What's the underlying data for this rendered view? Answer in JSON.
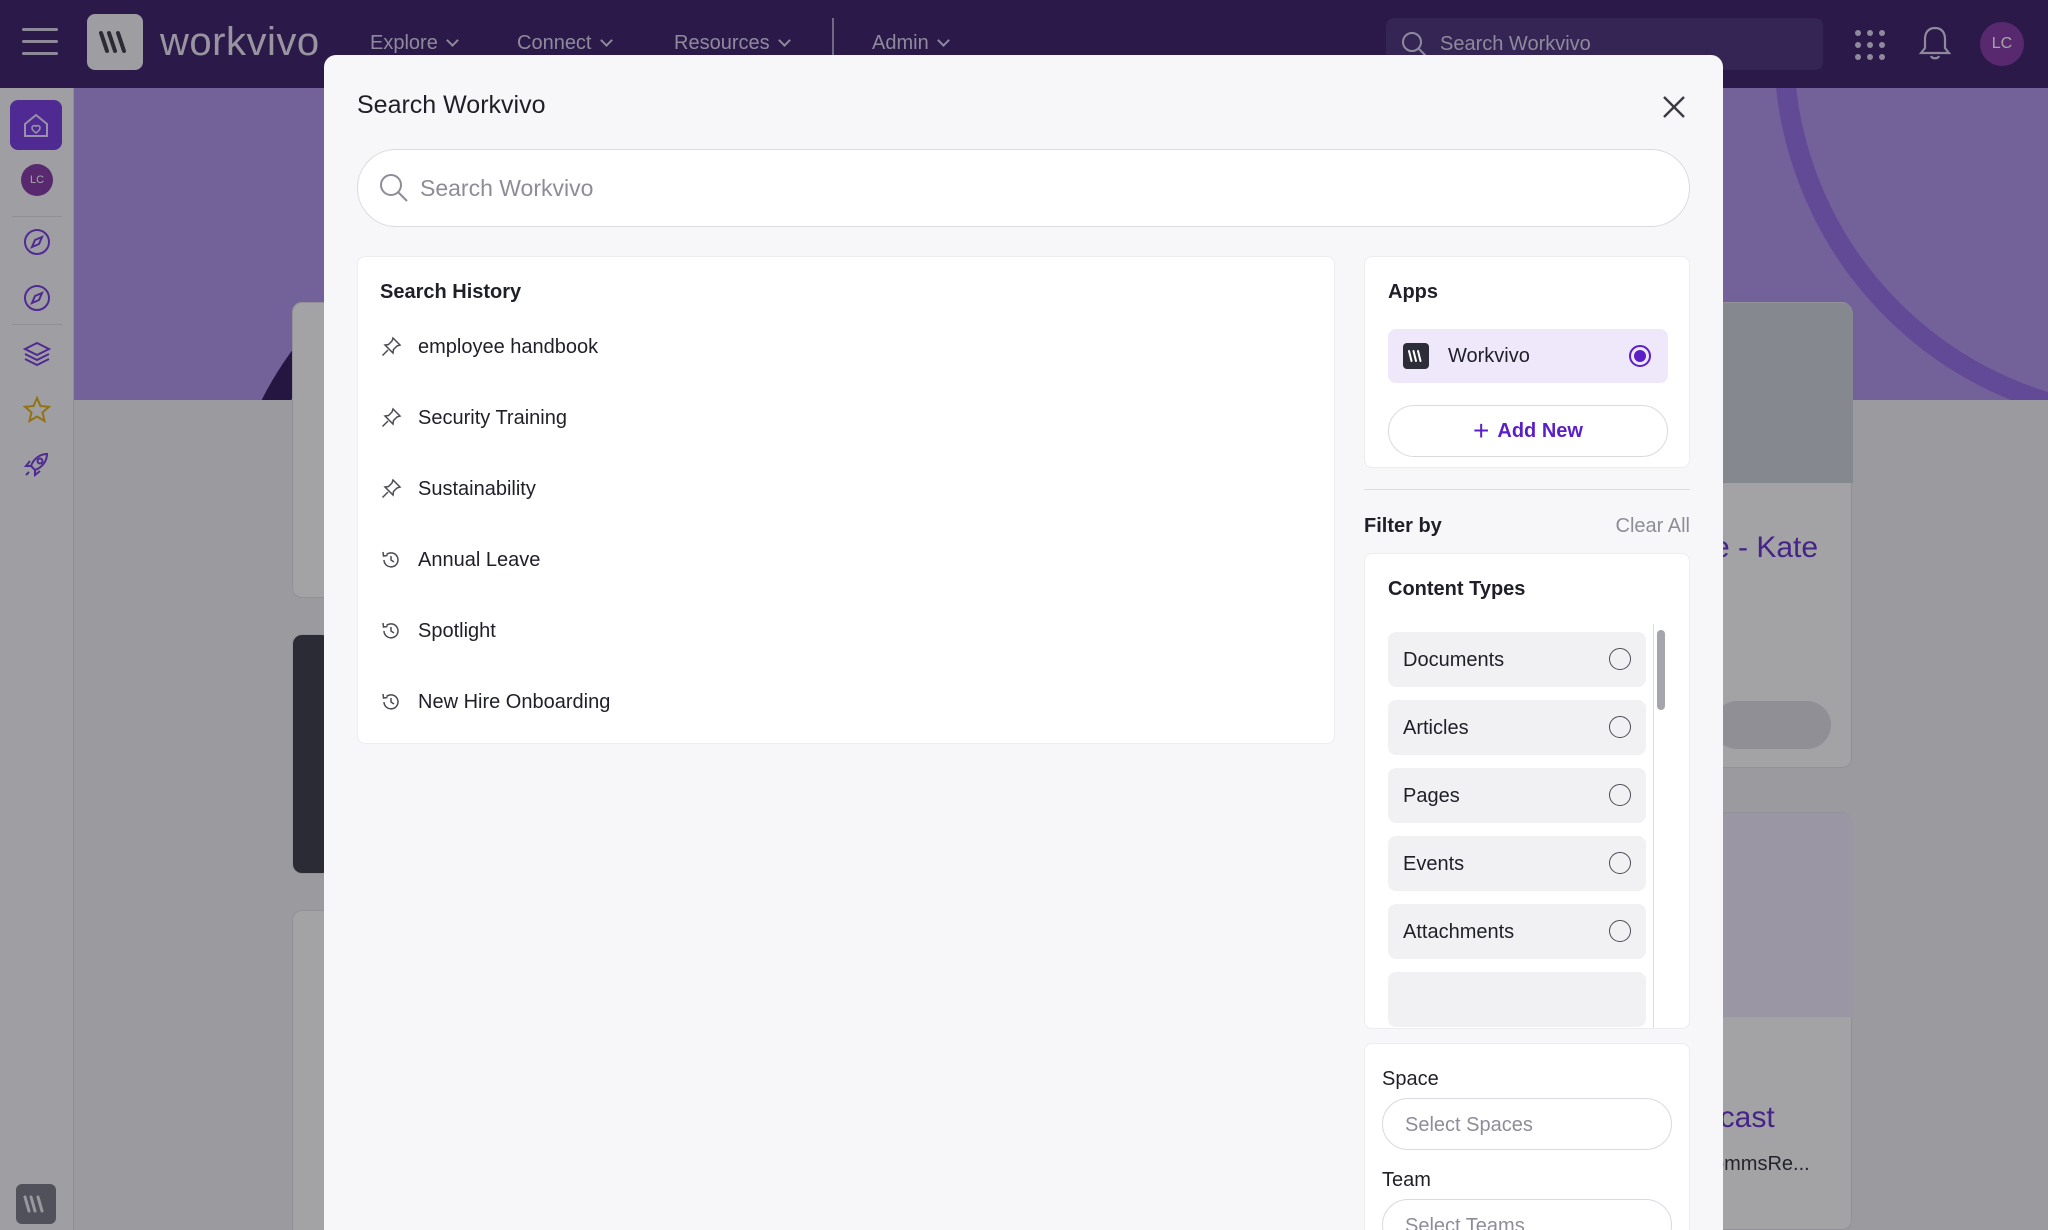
{
  "topbar": {
    "brand": "workvivo",
    "nav": [
      {
        "label": "Explore"
      },
      {
        "label": "Connect"
      },
      {
        "label": "Resources"
      },
      {
        "label": "Admin"
      }
    ],
    "search_placeholder": "Search Workvivo",
    "user_initials": "LC"
  },
  "rail": {
    "user_initials": "LC",
    "icons": [
      "home-icon",
      "compass-icon",
      "compass-icon",
      "layers-icon",
      "star-icon",
      "rocket-icon"
    ]
  },
  "background": {
    "card_title_right": "e - Kate",
    "card_title_right2": "lcast",
    "card_sub_right2": "ommsRe..."
  },
  "modal": {
    "title": "Search Workvivo",
    "search_placeholder": "Search Workvivo",
    "history": {
      "title": "Search History",
      "items": [
        {
          "label": "employee handbook",
          "icon": "pin-icon"
        },
        {
          "label": "Security Training",
          "icon": "pin-icon"
        },
        {
          "label": "Sustainability",
          "icon": "pin-icon"
        },
        {
          "label": "Annual Leave",
          "icon": "history-icon"
        },
        {
          "label": "Spotlight",
          "icon": "history-icon"
        },
        {
          "label": "New Hire Onboarding",
          "icon": "history-icon"
        }
      ]
    },
    "apps": {
      "title": "Apps",
      "items": [
        {
          "name": "Workvivo",
          "selected": true
        }
      ],
      "add_new_label": "Add New"
    },
    "filter": {
      "title": "Filter by",
      "clear_all": "Clear All",
      "content_types": {
        "title": "Content Types",
        "items": [
          "Documents",
          "Articles",
          "Pages",
          "Events",
          "Attachments"
        ]
      },
      "space": {
        "label": "Space",
        "placeholder": "Select Spaces"
      },
      "team": {
        "label": "Team",
        "placeholder": "Select Teams"
      }
    }
  },
  "colors": {
    "topbar": "#2c0f5c",
    "accent": "#5b1fc7",
    "hero": "#a98ae6"
  }
}
